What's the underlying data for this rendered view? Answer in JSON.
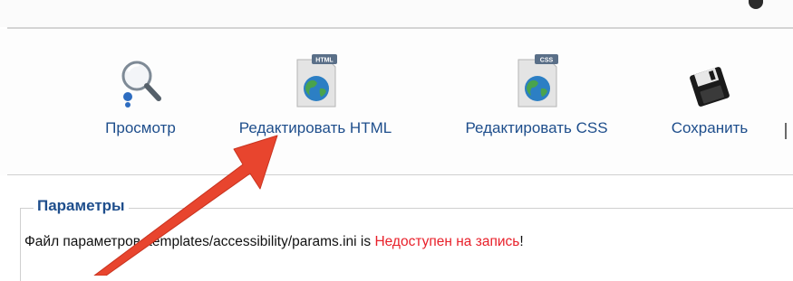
{
  "toolbar": {
    "buttons": [
      {
        "id": "preview",
        "label": "Просмотр",
        "icon": "magnifier-icon"
      },
      {
        "id": "edit-html",
        "label": "Редактировать HTML",
        "icon": "html-file-icon",
        "icon_badge": "HTML"
      },
      {
        "id": "edit-css",
        "label": "Редактировать CSS",
        "icon": "css-file-icon",
        "icon_badge": "CSS"
      },
      {
        "id": "save",
        "label": "Сохранить",
        "icon": "floppy-disk-icon"
      }
    ]
  },
  "params": {
    "legend": "Параметры",
    "message_prefix": "Файл параметров /templates/accessibility/params.ini is ",
    "message_status": "Недоступен на запись",
    "message_suffix": "!"
  },
  "colors": {
    "link_blue": "#1e4e8c",
    "warning_red": "#e8202a",
    "annotation_arrow": "#e8452e"
  }
}
